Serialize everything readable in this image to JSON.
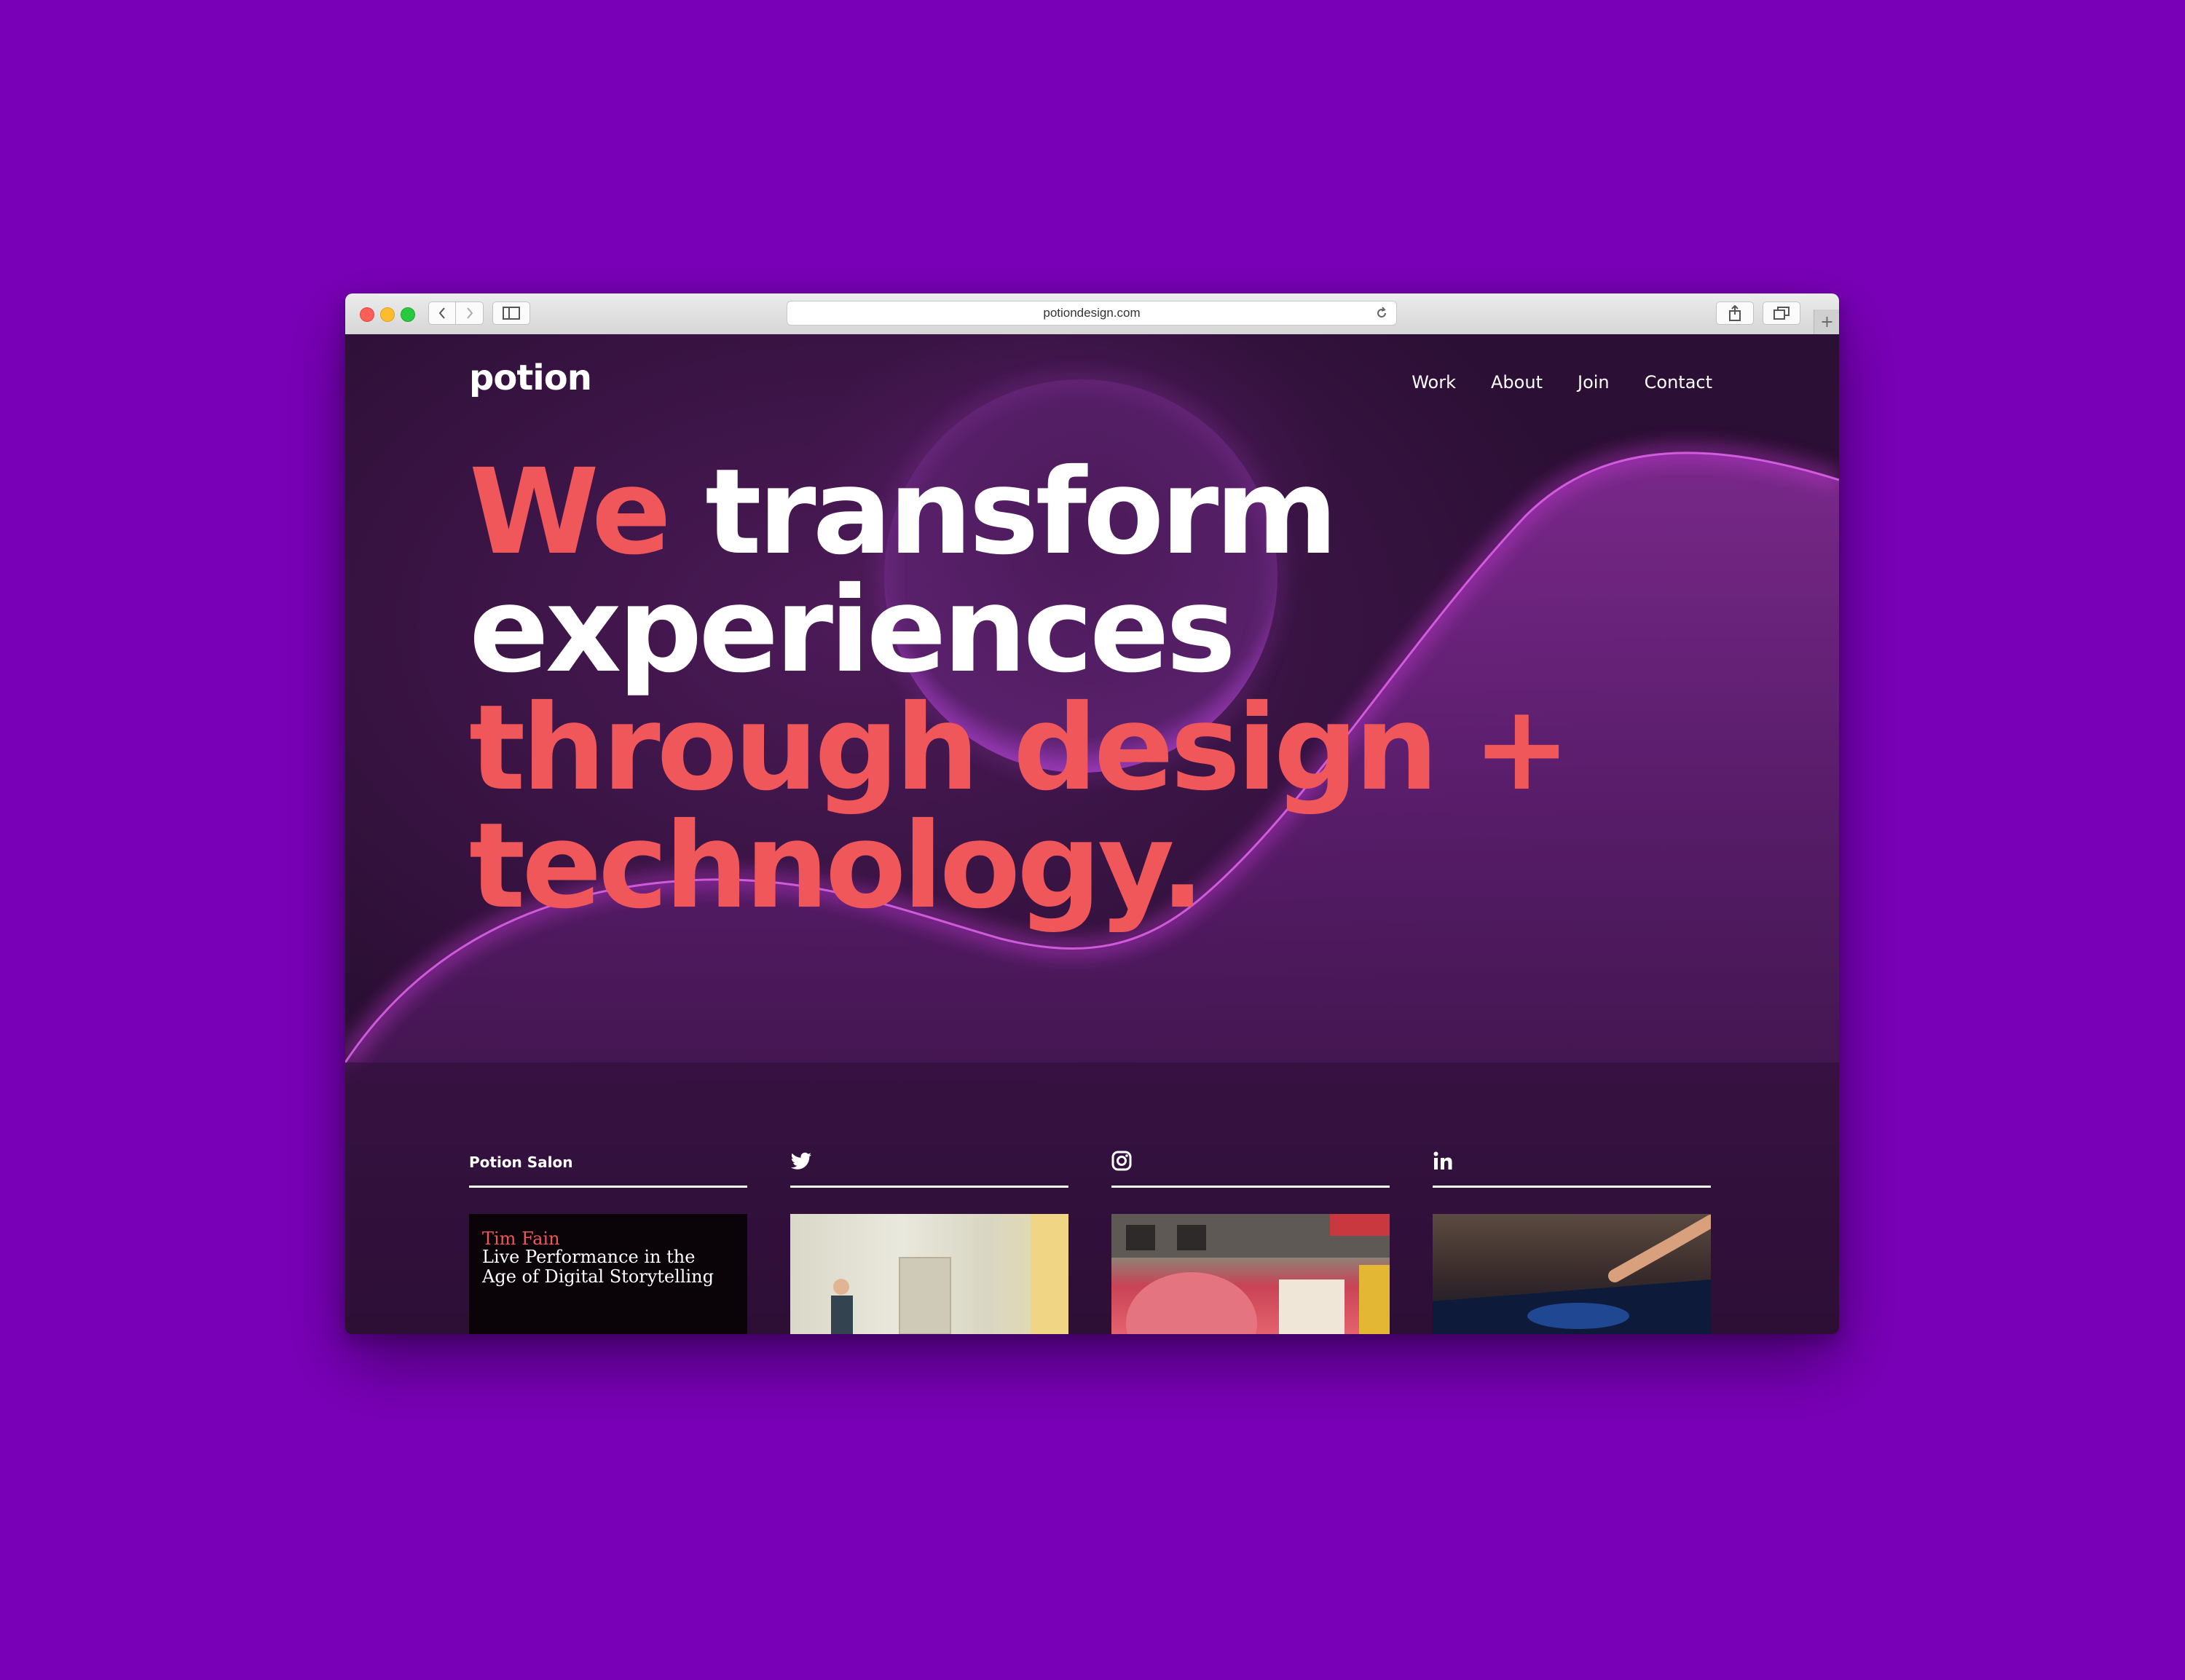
{
  "browser": {
    "url": "potiondesign.com"
  },
  "site": {
    "logo": "potion",
    "nav": [
      "Work",
      "About",
      "Join",
      "Contact"
    ],
    "colors": {
      "accent": "#f0575a",
      "background": "#2b0f34",
      "glow": "#d13be0",
      "frame": "#7a00b8"
    }
  },
  "hero": {
    "we": "We",
    "transform": "transform",
    "experiences": "experiences",
    "through": "through design +",
    "technology": "technology."
  },
  "feeds": {
    "salon": {
      "title": "Potion Salon",
      "speaker": "Tim Fain",
      "talk": "Live Performance in the Age of Digital Storytelling"
    },
    "twitter_icon": "twitter-icon",
    "instagram_icon": "instagram-icon",
    "linkedin_icon": "linkedin-icon"
  }
}
